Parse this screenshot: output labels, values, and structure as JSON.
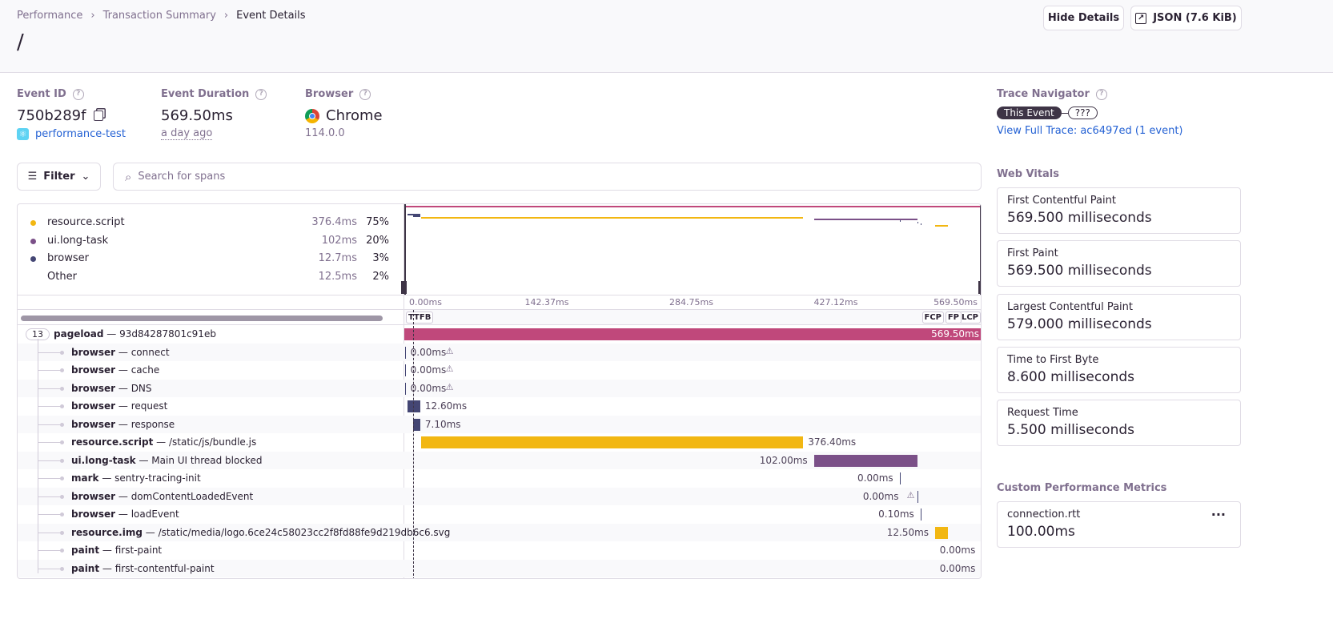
{
  "breadcrumbs": [
    "Performance",
    "Transaction Summary",
    "Event Details"
  ],
  "title": "/",
  "actions": {
    "hide_details": "Hide Details",
    "json": "JSON (7.6 KiB)"
  },
  "event": {
    "id_label": "Event ID",
    "id": "750b289f",
    "project": "performance-test",
    "duration_label": "Event Duration",
    "duration": "569.50ms",
    "time_ago": "a day ago",
    "browser_label": "Browser",
    "browser": "Chrome",
    "browser_version": "114.0.0"
  },
  "trace": {
    "label": "Trace Navigator",
    "this_event": "This Event",
    "unknown": "???",
    "view_full": "View Full Trace: ac6497ed (1 event)"
  },
  "filter": {
    "label": "Filter",
    "search_placeholder": "Search for spans"
  },
  "ops_breakdown": [
    {
      "name": "resource.script",
      "value": "376.4ms",
      "pct": "75%",
      "color": "#f2b712"
    },
    {
      "name": "ui.long-task",
      "value": "102ms",
      "pct": "20%",
      "color": "#7b5088"
    },
    {
      "name": "browser",
      "value": "12.7ms",
      "pct": "3%",
      "color": "#444674"
    },
    {
      "name": "Other",
      "value": "12.5ms",
      "pct": "2%",
      "color": ""
    }
  ],
  "axis": {
    "ticks": [
      "0.00ms",
      "142.37ms",
      "284.75ms",
      "427.12ms",
      "569.50ms"
    ],
    "total_ms": 569.5
  },
  "markers": {
    "left": [
      "TTFB"
    ],
    "right": [
      "FCP",
      "FP",
      "LCP"
    ],
    "ttfb_ms": 8.6
  },
  "root": {
    "count": "13",
    "op": "pageload",
    "desc": "93d84287801c91eb",
    "start": 0,
    "dur": 569.5,
    "label": "569.50ms",
    "color": "#c0487b"
  },
  "spans": [
    {
      "op": "browser",
      "desc": "connect",
      "start": 0.5,
      "dur": 0,
      "label": "0.00ms",
      "warn": true,
      "color": "#444674"
    },
    {
      "op": "browser",
      "desc": "cache",
      "start": 0.5,
      "dur": 0,
      "label": "0.00ms",
      "warn": true,
      "color": "#444674"
    },
    {
      "op": "browser",
      "desc": "DNS",
      "start": 0.5,
      "dur": 0,
      "label": "0.00ms",
      "warn": true,
      "color": "#444674"
    },
    {
      "op": "browser",
      "desc": "request",
      "start": 3.1,
      "dur": 12.6,
      "label": "12.60ms",
      "color": "#444674"
    },
    {
      "op": "browser",
      "desc": "response",
      "start": 8.6,
      "dur": 7.1,
      "label": "7.10ms",
      "color": "#444674"
    },
    {
      "op": "resource.script",
      "desc": "/static/js/bundle.js",
      "start": 16.6,
      "dur": 376.4,
      "label": "376.40ms",
      "color": "#f2b712"
    },
    {
      "op": "ui.long-task",
      "desc": "Main UI thread blocked",
      "start": 403.6,
      "dur": 102,
      "label": "102.00ms",
      "color": "#7b5088"
    },
    {
      "op": "mark",
      "desc": "sentry-tracing-init",
      "start": 488,
      "dur": 0,
      "label": "0.00ms",
      "color": "#444674"
    },
    {
      "op": "browser",
      "desc": "domContentLoadedEvent",
      "start": 506,
      "dur": 0,
      "label": "0.00ms",
      "warn": true,
      "color": "#444674"
    },
    {
      "op": "browser",
      "desc": "loadEvent",
      "start": 508.6,
      "dur": 0.1,
      "label": "0.10ms",
      "color": "#444674"
    },
    {
      "op": "resource.img",
      "desc": "/static/media/logo.6ce24c58023cc2f8fd88fe9d219db6c6.svg",
      "start": 523,
      "dur": 12.5,
      "label": "12.50ms",
      "color": "#f2b712"
    },
    {
      "op": "paint",
      "desc": "first-paint",
      "start": 569,
      "dur": 0,
      "label": "0.00ms",
      "color": "#444674"
    },
    {
      "op": "paint",
      "desc": "first-contentful-paint",
      "start": 569,
      "dur": 0,
      "label": "0.00ms",
      "color": "#444674"
    }
  ],
  "web_vitals": {
    "label": "Web Vitals",
    "items": [
      {
        "name": "First Contentful Paint",
        "value": "569.500 milliseconds"
      },
      {
        "name": "First Paint",
        "value": "569.500 milliseconds"
      },
      {
        "name": "Largest Contentful Paint",
        "value": "579.000 milliseconds"
      },
      {
        "name": "Time to First Byte",
        "value": "8.600 milliseconds"
      },
      {
        "name": "Request Time",
        "value": "5.500 milliseconds"
      }
    ]
  },
  "custom_metrics": {
    "label": "Custom Performance Metrics",
    "items": [
      {
        "name": "connection.rtt",
        "value": "100.00ms"
      }
    ]
  }
}
